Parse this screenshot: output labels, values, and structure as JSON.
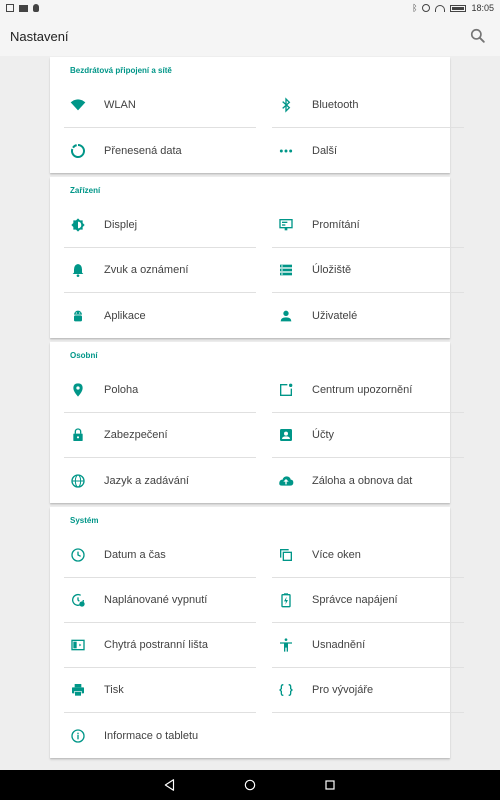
{
  "status_bar": {
    "time": "18:05",
    "left_icons": [
      "square-icon",
      "image-icon",
      "bug-icon"
    ],
    "right_icons": [
      "bluetooth-icon",
      "alarm-icon",
      "wifi-icon",
      "battery-icon"
    ]
  },
  "app_bar": {
    "title": "Nastavení",
    "search_icon": "search-icon"
  },
  "accent_color": "#009688",
  "sections": [
    {
      "header": "Bezdrátová připojení a sítě",
      "items": [
        {
          "label": "WLAN",
          "icon": "wifi-icon"
        },
        {
          "label": "Bluetooth",
          "icon": "bluetooth-icon"
        },
        {
          "label": "Přenesená data",
          "icon": "data-usage-icon"
        },
        {
          "label": "Další",
          "icon": "more-icon"
        }
      ]
    },
    {
      "header": "Zařízení",
      "items": [
        {
          "label": "Displej",
          "icon": "brightness-icon"
        },
        {
          "label": "Promítání",
          "icon": "cast-icon"
        },
        {
          "label": "Zvuk a oznámení",
          "icon": "bell-icon"
        },
        {
          "label": "Úložiště",
          "icon": "storage-icon"
        },
        {
          "label": "Aplikace",
          "icon": "android-icon"
        },
        {
          "label": "Uživatelé",
          "icon": "person-icon"
        }
      ]
    },
    {
      "header": "Osobní",
      "items": [
        {
          "label": "Poloha",
          "icon": "location-icon"
        },
        {
          "label": "Centrum upozornění",
          "icon": "notification-center-icon"
        },
        {
          "label": "Zabezpečení",
          "icon": "lock-icon"
        },
        {
          "label": "Účty",
          "icon": "account-box-icon"
        },
        {
          "label": "Jazyk a zadávání",
          "icon": "globe-icon"
        },
        {
          "label": "Záloha a obnova dat",
          "icon": "cloud-upload-icon"
        }
      ]
    },
    {
      "header": "Systém",
      "items": [
        {
          "label": "Datum a čas",
          "icon": "clock-icon"
        },
        {
          "label": "Více oken",
          "icon": "multi-window-icon"
        },
        {
          "label": "Naplánované vypnutí",
          "icon": "schedule-power-icon"
        },
        {
          "label": "Správce napájení",
          "icon": "battery-charging-icon"
        },
        {
          "label": "Chytrá postranní lišta",
          "icon": "smart-sidebar-icon"
        },
        {
          "label": "Usnadnění",
          "icon": "accessibility-icon"
        },
        {
          "label": "Tisk",
          "icon": "print-icon"
        },
        {
          "label": "Pro vývojáře",
          "icon": "code-braces-icon"
        },
        {
          "label": "Informace o tabletu",
          "icon": "info-icon"
        }
      ]
    }
  ],
  "nav_bar": {
    "back_icon": "back-icon",
    "home_icon": "home-icon",
    "recents_icon": "recents-icon"
  }
}
